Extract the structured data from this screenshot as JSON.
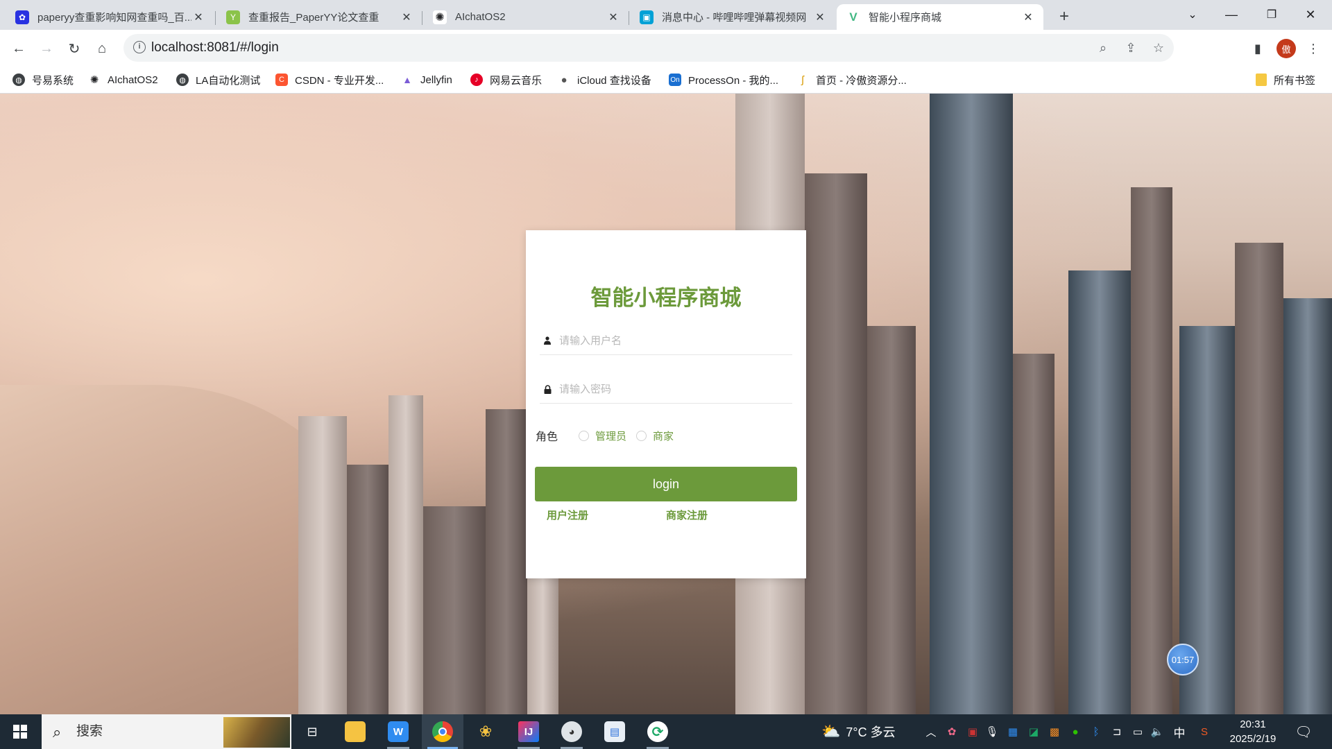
{
  "browser": {
    "tabs": [
      {
        "title": "paperyy查重影响知网查重吗_百...",
        "icon": "baidu-paw-icon",
        "color": "#2932e1"
      },
      {
        "title": "查重报告_PaperYY论文查重",
        "icon": "paperyy-icon",
        "color": "#8bc34a"
      },
      {
        "title": "AIchatOS2",
        "icon": "openai-icon",
        "color": "#202124"
      },
      {
        "title": "消息中心 - 哔哩哔哩弹幕视频网",
        "icon": "bilibili-tv-icon",
        "color": "#00a1d6"
      },
      {
        "title": "智能小程序商城",
        "icon": "vue-icon",
        "color": "#41b883"
      }
    ],
    "url": "localhost:8081/#/login",
    "profile_initial": "傲",
    "bookmarks": [
      {
        "label": "号易系统",
        "icon": "globe-icon",
        "color": "#3c4043"
      },
      {
        "label": "AIchatOS2",
        "icon": "openai-icon",
        "color": "#202124"
      },
      {
        "label": "LA自动化测试",
        "icon": "globe-icon",
        "color": "#3c4043"
      },
      {
        "label": "CSDN - 专业开发...",
        "icon": "csdn-icon",
        "color": "#fc5531"
      },
      {
        "label": "Jellyfin",
        "icon": "jellyfin-icon",
        "color": "#7b5cd6"
      },
      {
        "label": "网易云音乐",
        "icon": "netease-music-icon",
        "color": "#e60026"
      },
      {
        "label": "iCloud 查找设备",
        "icon": "apple-icon",
        "color": "#555555"
      },
      {
        "label": "ProcessOn - 我的...",
        "icon": "processon-icon",
        "color": "#1a6fd1"
      },
      {
        "label": "首页 - 冷傲资源分...",
        "icon": "resource-icon",
        "color": "#f0b000"
      }
    ],
    "all_bookmarks": "所有书签"
  },
  "login": {
    "title": "智能小程序商城",
    "username_placeholder": "请输入用户名",
    "password_placeholder": "请输入密码",
    "role_label": "角色",
    "roles": [
      "管理员",
      "商家"
    ],
    "login_button": "login",
    "user_register": "用户注册",
    "merchant_register": "商家注册",
    "accent_color": "#6c9a3b"
  },
  "overlay": {
    "timer": "01:57"
  },
  "taskbar": {
    "search_label": "搜索",
    "weather": "7°C 多云",
    "ime": "中",
    "time": "20:31",
    "date": "2025/2/19"
  }
}
